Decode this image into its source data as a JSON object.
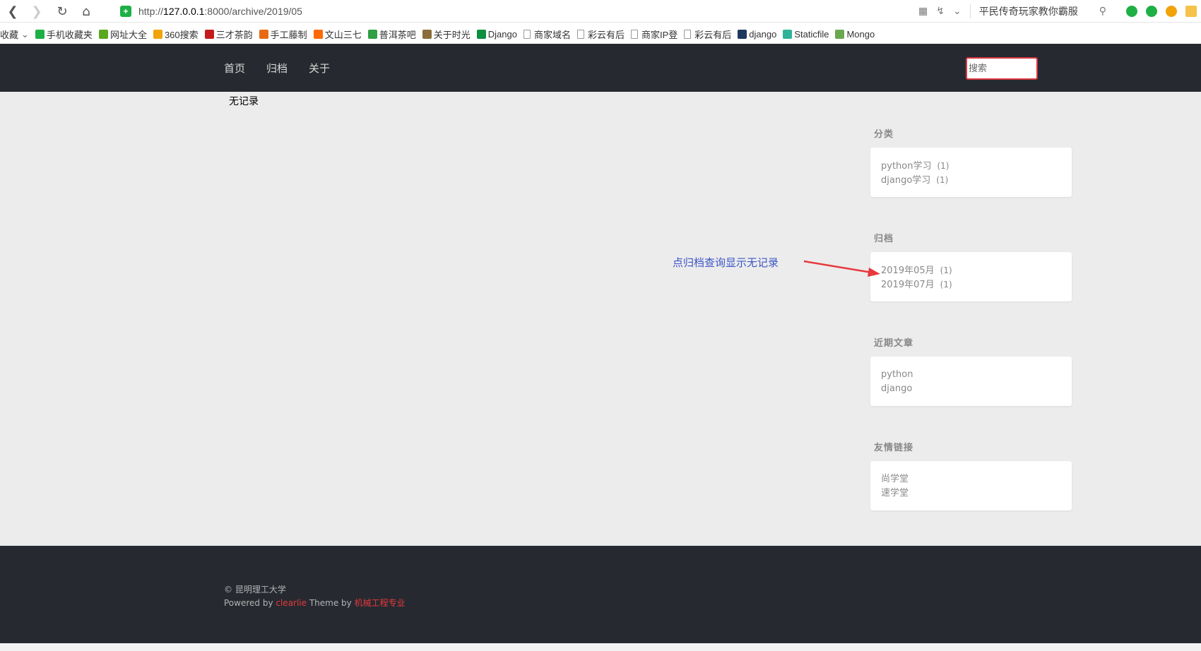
{
  "browser": {
    "url_prefix": "http://",
    "url_host": "127.0.0.1",
    "url_rest": ":8000/archive/2019/05",
    "search_hint": "平民传奇玩家教你霸服"
  },
  "bookmarks": [
    {
      "label": "收藏",
      "icon": "dropdown",
      "color": "#666"
    },
    {
      "label": "手机收藏夹",
      "icon": "phone-icon",
      "color": "#1eb045"
    },
    {
      "label": "网址大全",
      "icon": "hao-icon",
      "color": "#5aa81e"
    },
    {
      "label": "360搜索",
      "icon": "360-icon",
      "color": "#f0a30a"
    },
    {
      "label": "三才茶韵",
      "icon": "sancai-icon",
      "color": "#c41c1c"
    },
    {
      "label": "手工藤制",
      "icon": "hand-icon",
      "color": "#e86a10"
    },
    {
      "label": "文山三七",
      "icon": "ali-icon",
      "color": "#ff6a00"
    },
    {
      "label": "普洱茶吧",
      "icon": "tea-icon",
      "color": "#2f9e44"
    },
    {
      "label": "关于时光",
      "icon": "time-icon",
      "color": "#8a6d3b"
    },
    {
      "label": "Django",
      "icon": "dj-icon",
      "color": "#0c8f3f"
    },
    {
      "label": "商家域名",
      "icon": "doc-icon",
      "color": ""
    },
    {
      "label": "彩云有后",
      "icon": "doc-icon",
      "color": ""
    },
    {
      "label": "商家IP登",
      "icon": "doc-icon",
      "color": ""
    },
    {
      "label": "彩云有后",
      "icon": "doc-icon",
      "color": ""
    },
    {
      "label": "django",
      "icon": "lj-icon",
      "color": "#1f3a5f"
    },
    {
      "label": "Staticfile",
      "icon": "staticfile-icon",
      "color": "#2eb398"
    },
    {
      "label": "Mongo",
      "icon": "mongo-icon",
      "color": "#6aa84f"
    }
  ],
  "nav": {
    "home": "首页",
    "archive": "归档",
    "about": "关于",
    "search_placeholder": "搜索"
  },
  "main": {
    "empty_message": "无记录"
  },
  "sidebar": {
    "categories": {
      "title": "分类",
      "items": [
        {
          "label": "python学习",
          "count": "(1)"
        },
        {
          "label": "django学习",
          "count": "(1)"
        }
      ]
    },
    "archives": {
      "title": "归档",
      "items": [
        {
          "label": "2019年05月",
          "count": "(1)"
        },
        {
          "label": "2019年07月",
          "count": "(1)"
        }
      ]
    },
    "recent": {
      "title": "近期文章",
      "items": [
        {
          "label": "python"
        },
        {
          "label": "django"
        }
      ]
    },
    "links": {
      "title": "友情链接",
      "items": [
        {
          "label": "尚学堂"
        },
        {
          "label": "速学堂"
        }
      ]
    }
  },
  "annotation": {
    "text": "点归档查询显示无记录",
    "color": "#3c55c7",
    "arrow_color": "#e8383d"
  },
  "footer": {
    "copyright": "© 昆明理工大学",
    "powered_prefix": "Powered by ",
    "powered_link": "clearlie",
    "theme_text": " Theme by ",
    "theme_link": "机械工程专业"
  },
  "colors": {
    "header_bg": "#262a30",
    "content_bg": "#ececec",
    "accent_red": "#e8383d"
  }
}
